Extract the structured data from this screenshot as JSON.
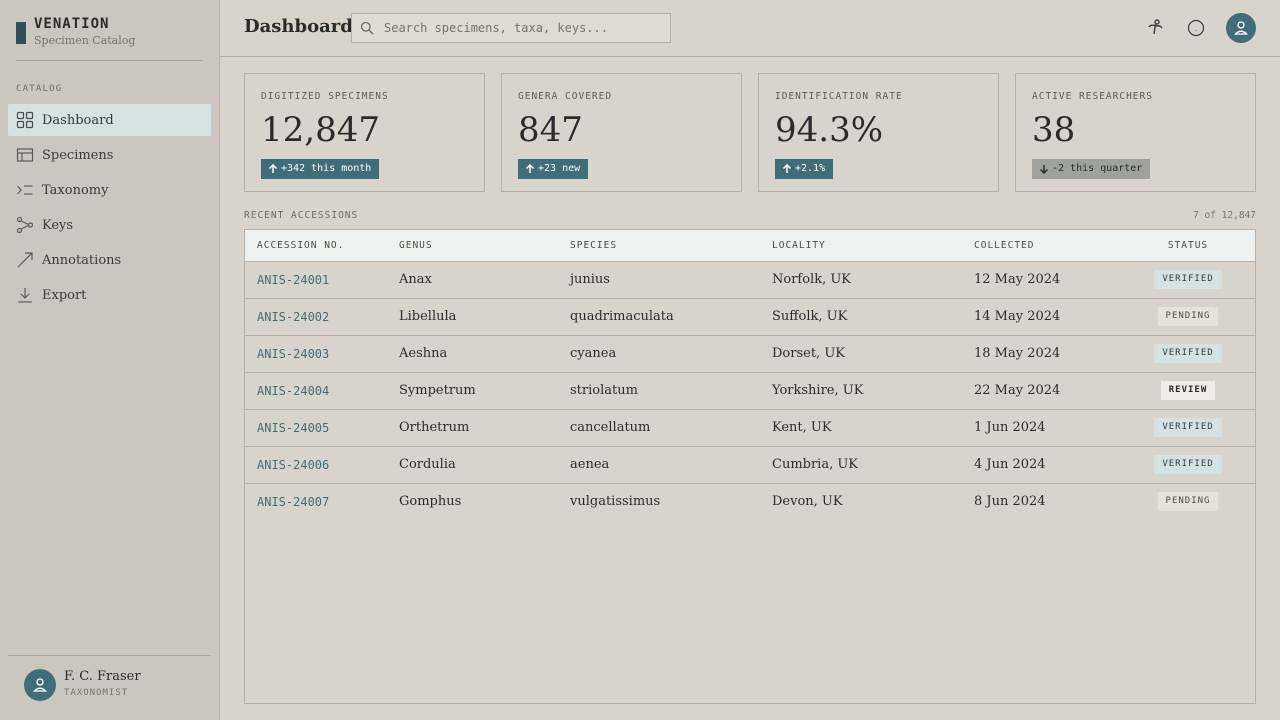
{
  "brand": {
    "name": "VENATION",
    "subtitle": "Specimen Catalog"
  },
  "sidebar": {
    "section_label": "CATALOG",
    "items": [
      {
        "label": "Dashboard",
        "icon": "grid-icon",
        "active": true
      },
      {
        "label": "Specimens",
        "icon": "table-icon",
        "active": false
      },
      {
        "label": "Taxonomy",
        "icon": "tree-icon",
        "active": false
      },
      {
        "label": "Keys",
        "icon": "branch-icon",
        "active": false
      },
      {
        "label": "Annotations",
        "icon": "pen-icon",
        "active": false
      },
      {
        "label": "Export",
        "icon": "download-icon",
        "active": false
      }
    ]
  },
  "user": {
    "name": "F. C. Fraser",
    "role": "TAXONOMIST"
  },
  "header": {
    "title": "Dashboard",
    "search_placeholder": "Search specimens, taxa, keys..."
  },
  "kpis": [
    {
      "label": "DIGITIZED SPECIMENS",
      "value": "12,847",
      "badge": "+342 this month",
      "trend": "up"
    },
    {
      "label": "GENERA COVERED",
      "value": "847",
      "badge": "+23 new",
      "trend": "up"
    },
    {
      "label": "IDENTIFICATION RATE",
      "value": "94.3%",
      "badge": "+2.1%",
      "trend": "up"
    },
    {
      "label": "ACTIVE RESEARCHERS",
      "value": "38",
      "badge": "-2 this quarter",
      "trend": "down"
    }
  ],
  "accessions": {
    "label": "RECENT ACCESSIONS",
    "count": "7 of 12,847",
    "columns": [
      "ACCESSION NO.",
      "GENUS",
      "SPECIES",
      "LOCALITY",
      "COLLECTED",
      "STATUS"
    ],
    "rows": [
      {
        "id": "ANIS-24001",
        "genus": "Anax",
        "species": "junius",
        "locality": "Norfolk, UK",
        "collected": "12 May 2024",
        "status": "VERIFIED"
      },
      {
        "id": "ANIS-24002",
        "genus": "Libellula",
        "species": "quadrimaculata",
        "locality": "Suffolk, UK",
        "collected": "14 May 2024",
        "status": "PENDING"
      },
      {
        "id": "ANIS-24003",
        "genus": "Aeshna",
        "species": "cyanea",
        "locality": "Dorset, UK",
        "collected": "18 May 2024",
        "status": "VERIFIED"
      },
      {
        "id": "ANIS-24004",
        "genus": "Sympetrum",
        "species": "striolatum",
        "locality": "Yorkshire, UK",
        "collected": "22 May 2024",
        "status": "REVIEW"
      },
      {
        "id": "ANIS-24005",
        "genus": "Orthetrum",
        "species": "cancellatum",
        "locality": "Kent, UK",
        "collected": "1 Jun 2024",
        "status": "VERIFIED"
      },
      {
        "id": "ANIS-24006",
        "genus": "Cordulia",
        "species": "aenea",
        "locality": "Cumbria, UK",
        "collected": "4 Jun 2024",
        "status": "VERIFIED"
      },
      {
        "id": "ANIS-24007",
        "genus": "Gomphus",
        "species": "vulgatissimus",
        "locality": "Devon, UK",
        "collected": "8 Jun 2024",
        "status": "PENDING"
      }
    ]
  },
  "colors": {
    "accent": "#3f6d79",
    "brand_mark": "#2e4f57",
    "background": "#d8d4cc",
    "sidebar": "#cbc7be"
  }
}
